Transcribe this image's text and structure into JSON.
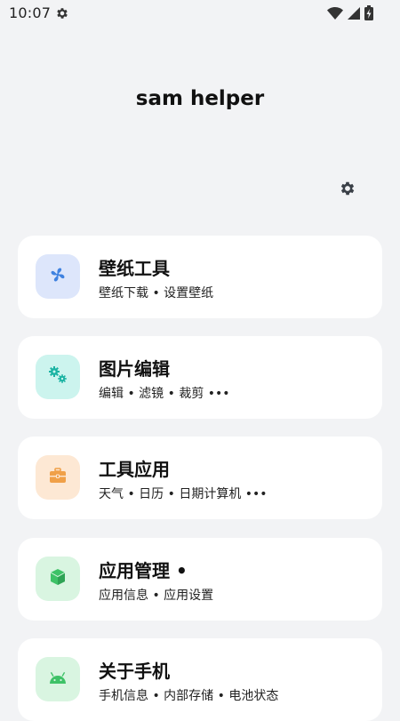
{
  "status_bar": {
    "time": "10:07",
    "settings_icon": "gear-icon",
    "wifi_icon": "wifi-icon",
    "signal_icon": "signal-icon",
    "battery_icon": "battery-charging-icon"
  },
  "header": {
    "title": "sam helper",
    "settings_icon": "gear-icon"
  },
  "colors": {
    "background": "#f2f3f5",
    "card_background": "#ffffff",
    "wallpaper_icon_bg": "#dde6fb",
    "wallpaper_icon": "#3f82e0",
    "image_edit_icon_bg": "#ccf4ee",
    "image_edit_icon": "#1bb3a3",
    "tools_icon_bg": "#fde8d4",
    "tools_icon": "#f0a048",
    "app_manage_icon_bg": "#d9f5e1",
    "app_manage_icon": "#3ec267",
    "about_icon_bg": "#d9f5e1",
    "about_icon": "#3ec267"
  },
  "cards": [
    {
      "icon": "fan-icon",
      "title": "壁纸工具",
      "subtitle": "壁纸下载 • 设置壁纸"
    },
    {
      "icon": "gears-icon",
      "title": "图片编辑",
      "subtitle": "编辑 • 滤镜 • 裁剪 •••"
    },
    {
      "icon": "toolbox-icon",
      "title": "工具应用",
      "subtitle": "天气 • 日历 • 日期计算机 •••"
    },
    {
      "icon": "cube-icon",
      "title": "应用管理 •",
      "subtitle": "应用信息 • 应用设置"
    },
    {
      "icon": "android-icon",
      "title": "关于手机",
      "subtitle": "手机信息 • 内部存储 • 电池状态"
    }
  ]
}
